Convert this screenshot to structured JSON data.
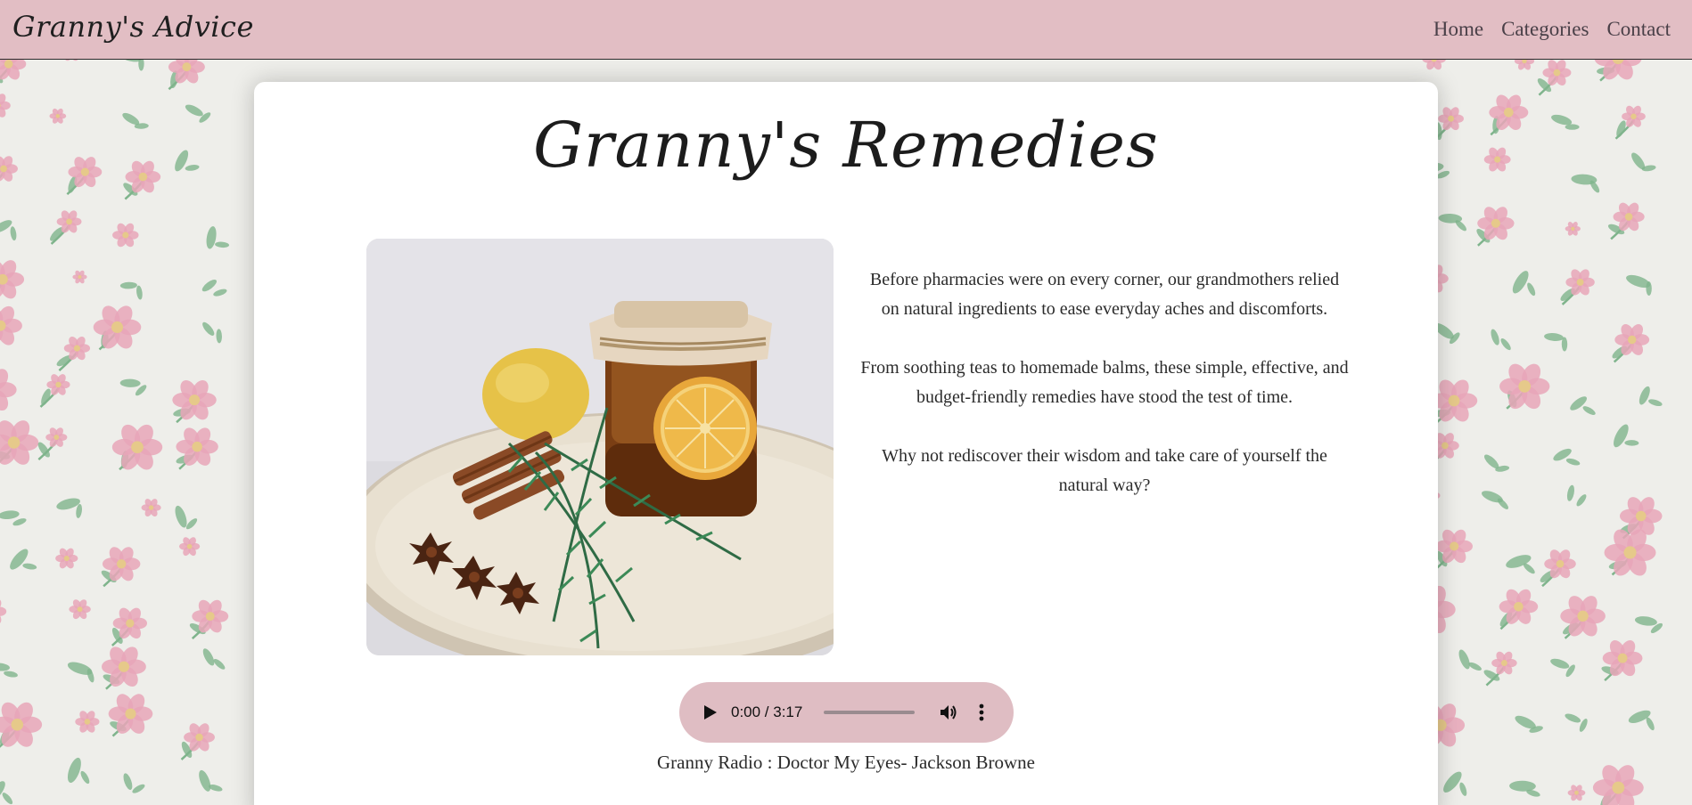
{
  "navbar": {
    "brand": "Granny's Advice",
    "links": [
      "Home",
      "Categories",
      "Contact"
    ]
  },
  "main": {
    "title": "Granny's Remedies",
    "paragraphs": [
      "Before pharmacies were on every corner, our grandmothers relied on natural ingredients to ease everyday aches and discomforts.",
      "From soothing teas to homemade balms, these simple, effective, and budget-friendly remedies have stood the test of time.",
      "Why not rediscover their wisdom and take care of yourself the natural way?"
    ],
    "image": {
      "subject": "honey jar with lemon slice, rosemary, cinnamon sticks and star anise on a wooden tray"
    },
    "audio": {
      "time": "0:00 / 3:17",
      "progress": 0,
      "caption": "Granny Radio : Doctor My Eyes- Jackson Browne"
    }
  },
  "colors": {
    "navbar_bg": "#e2bec4",
    "audio_bg": "#dfbdc3",
    "card_bg": "#ffffff",
    "wallpaper_bg": "#eeeeea",
    "flower_pink": "#e8a6b8",
    "leaf_green": "#7fb48c"
  },
  "icons": {
    "play": "play-icon",
    "volume": "volume-icon",
    "more": "more-options-icon"
  }
}
